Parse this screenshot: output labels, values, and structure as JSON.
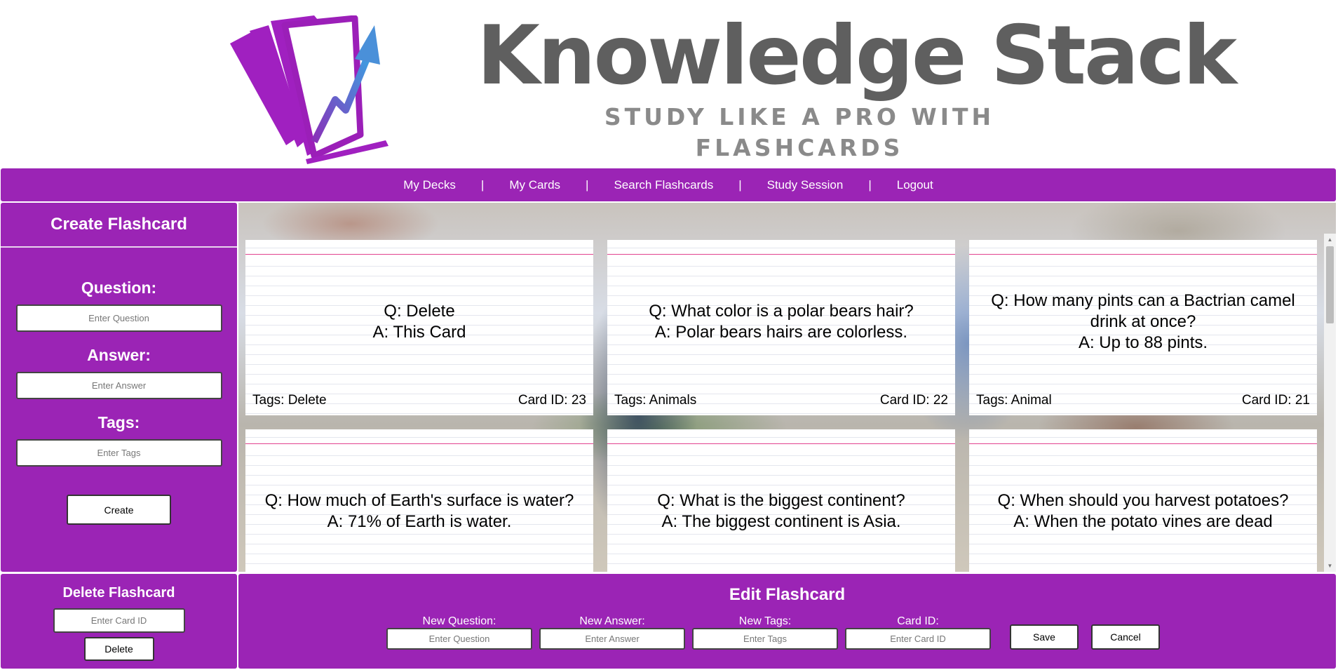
{
  "brand": {
    "title": "Knowledge Stack",
    "tagline_line1": "STUDY LIKE A PRO WITH",
    "tagline_line2": "FLASHCARDS",
    "colors": {
      "primary": "#9b24b5",
      "title": "#5f5f5f",
      "logo_arrow": "#4a90d9"
    }
  },
  "nav": {
    "items": [
      "My Decks",
      "My Cards",
      "Search Flashcards",
      "Study Session",
      "Logout"
    ],
    "separator": "|"
  },
  "create": {
    "title": "Create Flashcard",
    "question_label": "Question:",
    "question_placeholder": "Enter Question",
    "answer_label": "Answer:",
    "answer_placeholder": "Enter Answer",
    "tags_label": "Tags:",
    "tags_placeholder": "Enter Tags",
    "button": "Create"
  },
  "delete": {
    "title": "Delete Flashcard",
    "placeholder": "Enter Card ID",
    "button": "Delete"
  },
  "edit": {
    "title": "Edit Flashcard",
    "question_label": "New Question:",
    "question_placeholder": "Enter Question",
    "answer_label": "New Answer:",
    "answer_placeholder": "Enter Answer",
    "tags_label": "New Tags:",
    "tags_placeholder": "Enter Tags",
    "id_label": "Card ID:",
    "id_placeholder": "Enter Card ID",
    "save_button": "Save",
    "cancel_button": "Cancel"
  },
  "cards": [
    {
      "question": "Q: Delete",
      "answer": "A: This Card",
      "tags": "Tags: Delete",
      "card_id": "Card ID: 23"
    },
    {
      "question": "Q: What color is a polar bears hair?",
      "answer": "A: Polar bears hairs are colorless.",
      "tags": "Tags: Animals",
      "card_id": "Card ID: 22"
    },
    {
      "question": "Q: How many pints can a Bactrian camel drink at once?",
      "answer": "A: Up to 88 pints.",
      "tags": "Tags: Animal",
      "card_id": "Card ID: 21"
    },
    {
      "question": "Q: How much of Earth's surface is water?",
      "answer": "A: 71% of Earth is water.",
      "tags": "",
      "card_id": ""
    },
    {
      "question": "Q: What is the biggest continent?",
      "answer": "A: The biggest continent is Asia.",
      "tags": "",
      "card_id": ""
    },
    {
      "question": "Q: When should you harvest potatoes?",
      "answer": "A: When the potato vines are dead",
      "tags": "",
      "card_id": ""
    }
  ]
}
